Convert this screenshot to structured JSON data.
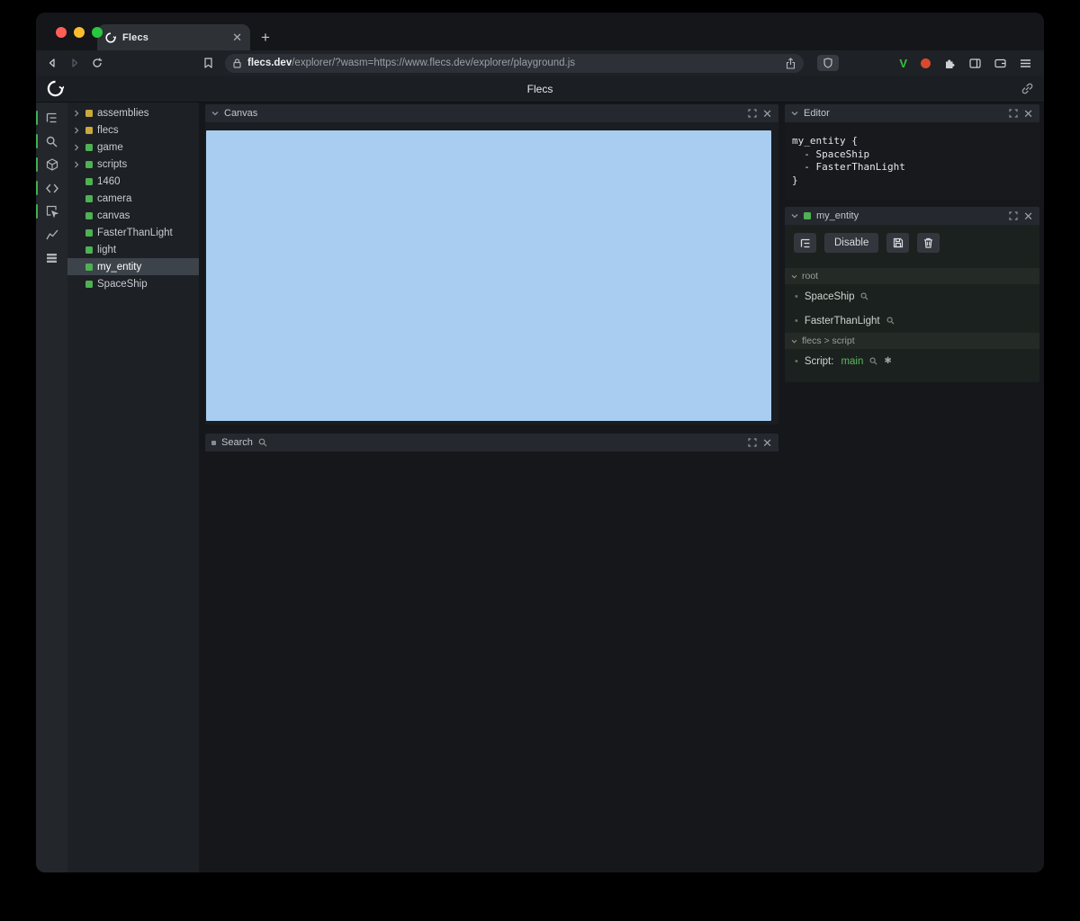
{
  "browser": {
    "tab": {
      "title": "Flecs"
    },
    "new_tab": "+",
    "url": {
      "domain": "flecs.dev",
      "path": "/explorer/?wasm=https://www.flecs.dev/explorer/playground.js"
    }
  },
  "app": {
    "title": "Flecs",
    "colors": {
      "entity_green": "#4fb054",
      "module_yellow": "#c9a93e",
      "canvas_blue": "#a8cdf0",
      "script_green": "#5fb85f"
    },
    "tree": {
      "items": [
        {
          "label": "assemblies",
          "color": "#c9a93e",
          "expandable": true
        },
        {
          "label": "flecs",
          "color": "#c9a93e",
          "expandable": true
        },
        {
          "label": "game",
          "color": "#4fb054",
          "expandable": true
        },
        {
          "label": "scripts",
          "color": "#4fb054",
          "expandable": true
        },
        {
          "label": "1460",
          "color": "#4fb054",
          "expandable": false
        },
        {
          "label": "camera",
          "color": "#4fb054",
          "expandable": false
        },
        {
          "label": "canvas",
          "color": "#4fb054",
          "expandable": false
        },
        {
          "label": "FasterThanLight",
          "color": "#4fb054",
          "expandable": false
        },
        {
          "label": "light",
          "color": "#4fb054",
          "expandable": false
        },
        {
          "label": "my_entity",
          "color": "#4fb054",
          "expandable": false,
          "selected": true
        },
        {
          "label": "SpaceShip",
          "color": "#4fb054",
          "expandable": false
        }
      ]
    },
    "panels": {
      "canvas": {
        "title": "Canvas"
      },
      "search": {
        "title": "Search"
      },
      "editor": {
        "title": "Editor",
        "code": [
          "my_entity {",
          "  - SpaceShip",
          "  - FasterThanLight",
          "}"
        ]
      },
      "entity": {
        "title": "my_entity",
        "disable_label": "Disable",
        "sections": [
          {
            "title": "root",
            "items": [
              "SpaceShip",
              "FasterThanLight"
            ]
          },
          {
            "title": "flecs > script",
            "script_label": "Script:",
            "script_value": "main"
          }
        ]
      }
    }
  }
}
